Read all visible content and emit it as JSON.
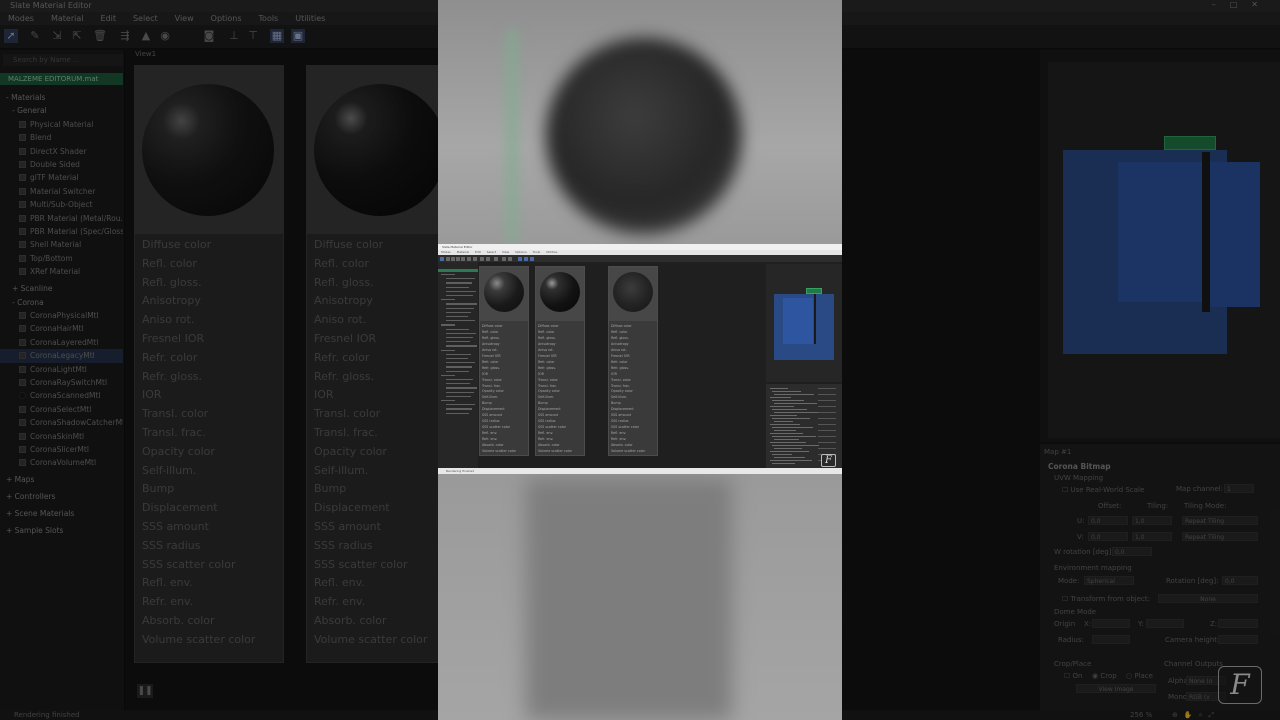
{
  "app": {
    "title": "Slate Material Editor",
    "menus": [
      "Modes",
      "Material",
      "Edit",
      "Select",
      "View",
      "Options",
      "Tools",
      "Utilities"
    ]
  },
  "left_panel": {
    "search_placeholder": "Search by Name ...",
    "active_material": "MALZEME EDITORUM.mat",
    "items": [
      {
        "kind": "cat",
        "label": "- Materials"
      },
      {
        "kind": "sub",
        "label": "- General"
      },
      {
        "kind": "mat",
        "label": "Physical Material"
      },
      {
        "kind": "mat",
        "label": "Blend"
      },
      {
        "kind": "mat",
        "label": "DirectX Shader"
      },
      {
        "kind": "mat",
        "label": "Double Sided"
      },
      {
        "kind": "mat",
        "label": "glTF Material"
      },
      {
        "kind": "mat",
        "label": "Material Switcher"
      },
      {
        "kind": "mat",
        "label": "Multi/Sub-Object"
      },
      {
        "kind": "mat",
        "label": "PBR Material (Metal/Rou..."
      },
      {
        "kind": "mat",
        "label": "PBR Material (Spec/Gloss)"
      },
      {
        "kind": "mat",
        "label": "Shell Material"
      },
      {
        "kind": "mat",
        "label": "Top/Bottom"
      },
      {
        "kind": "mat",
        "label": "XRef Material"
      },
      {
        "kind": "sub",
        "label": "+ Scanline"
      },
      {
        "kind": "sub",
        "label": "- Corona"
      },
      {
        "kind": "mat",
        "label": "CoronaPhysicalMtl"
      },
      {
        "kind": "mat",
        "label": "CoronaHairMtl"
      },
      {
        "kind": "mat",
        "label": "CoronaLayeredMtl"
      },
      {
        "kind": "mat",
        "label": "CoronaLegacyMtl",
        "highlight": true
      },
      {
        "kind": "mat",
        "label": "CoronaLightMtl"
      },
      {
        "kind": "mat",
        "label": "CoronaRaySwitchMtl"
      },
      {
        "kind": "mat",
        "label": "CoronaScannedMtl",
        "dark": true
      },
      {
        "kind": "mat",
        "label": "CoronaSelectMtl"
      },
      {
        "kind": "mat",
        "label": "CoronaShadowCatcherMtl"
      },
      {
        "kind": "mat",
        "label": "CoronaSkinMtl"
      },
      {
        "kind": "mat",
        "label": "CoronaSlicerMtl"
      },
      {
        "kind": "mat",
        "label": "CoronaVolumeMtl"
      },
      {
        "kind": "cat",
        "label": "+ Maps"
      },
      {
        "kind": "cat",
        "label": "+ Controllers"
      },
      {
        "kind": "cat",
        "label": "+ Scene Materials"
      },
      {
        "kind": "cat",
        "label": "+ Sample Slots"
      }
    ]
  },
  "view": {
    "tab": "View1",
    "node1_slots": [
      "Diffuse color",
      "Refl. color",
      "Refl. gloss.",
      "Anisotropy",
      "Aniso rot.",
      "Fresnel IOR",
      "Refr. color",
      "Refr. gloss.",
      "IOR",
      "Transl. color",
      "Transl. frac.",
      "Opacity color",
      "Self-illum.",
      "Bump",
      "Displacement",
      "SSS amount",
      "SSS radius",
      "SSS scatter color",
      "Refl. env.",
      "Refr. env.",
      "Absorb. color",
      "Volume scatter color"
    ],
    "node2_slots": [
      "Diffuse color",
      "Refl. color",
      "Refl. gloss.",
      "Anisotropy",
      "Aniso rot.",
      "Fresnel IOR",
      "Refr. color",
      "Refr. gloss.",
      "IOR",
      "Transl. color",
      "Transl. frac.",
      "Opacity color",
      "Self-illum.",
      "Bump",
      "Displacement",
      "SSS amount",
      "SSS radius",
      "SSS scatter color",
      "Refl. env.",
      "Refr. env.",
      "Absorb. color",
      "Volume scatter color"
    ]
  },
  "props": {
    "map_title": "Map #1",
    "rollout": "Corona Bitmap",
    "uvw": "UVW Mapping",
    "real_world": "Use Real-World Scale",
    "map_channel_label": "Map channel:",
    "map_channel": "1",
    "offset": "Offset:",
    "tiling": "Tiling:",
    "tiling_mode": "Tiling Mode:",
    "u_label": "U:",
    "v_label": "V:",
    "u_offset": "0,0",
    "u_tiling": "1,0",
    "v_offset": "0,0",
    "v_tiling": "1,0",
    "u_mode": "Repeat Tiling",
    "v_mode": "Repeat Tiling",
    "w_rot": "W rotation [deg]:",
    "w_rot_val": "0,0",
    "env_mapping": "Environment mapping",
    "mode_label": "Mode:",
    "mode_val": "Spherical",
    "rotation_label": "Rotation [deg]:",
    "rotation_val": "0,0",
    "transform_label": "Transform from object:",
    "transform_val": "None",
    "dome_mode": "Dome Mode",
    "origin": "Origin",
    "x": "X:",
    "y": "Y:",
    "z": "Z:",
    "radius": "Radius:",
    "camera_height": "Camera height:",
    "crop_place": "Crop/Place",
    "on": "On",
    "crop": "Crop",
    "place": "Place",
    "view_image": "View Image",
    "channel_outputs": "Channel Outputs",
    "alpha": "Alpha:",
    "alpha_val": "None (o",
    "mono": "Mono:",
    "mono_val": "RGB (v"
  },
  "status": {
    "text": "Rendering finished",
    "zoom": "256 %"
  },
  "logo": "F"
}
